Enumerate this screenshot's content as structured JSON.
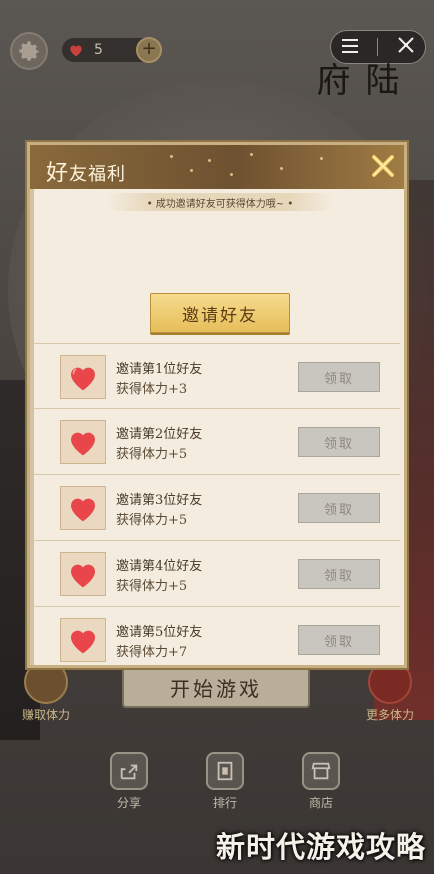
{
  "top_bar": {
    "hearts_count": "5",
    "plus_symbol": "+",
    "menu_icon": "menu-icon",
    "close_icon": "close-icon",
    "side_title": "陆府"
  },
  "scene": {
    "start_button": "开始游戏",
    "left_button_label": "赚取体力",
    "right_button_label": "更多体力"
  },
  "bottom_nav": {
    "items": [
      {
        "label": "分享",
        "icon": "share-icon"
      },
      {
        "label": "排行",
        "icon": "rank-icon"
      },
      {
        "label": "商店",
        "icon": "shop-icon"
      }
    ]
  },
  "modal": {
    "title_big": "好",
    "title_rest": "友福利",
    "banner": "• 成功邀请好友可获得体力哦~ •",
    "invite_button": "邀请好友",
    "accent_color": "#e6bd5a",
    "items": [
      {
        "title": "邀请第1位好友",
        "reward": "获得体力+3",
        "claim": "领取",
        "icon": "heart-icon"
      },
      {
        "title": "邀请第2位好友",
        "reward": "获得体力+5",
        "claim": "领取",
        "icon": "heart-icon"
      },
      {
        "title": "邀请第3位好友",
        "reward": "获得体力+5",
        "claim": "领取",
        "icon": "heart-icon"
      },
      {
        "title": "邀请第4位好友",
        "reward": "获得体力+5",
        "claim": "领取",
        "icon": "heart-icon"
      },
      {
        "title": "邀请第5位好友",
        "reward": "获得体力+7",
        "claim": "领取",
        "icon": "heart-icon"
      }
    ]
  },
  "watermark": "新时代游戏攻略"
}
